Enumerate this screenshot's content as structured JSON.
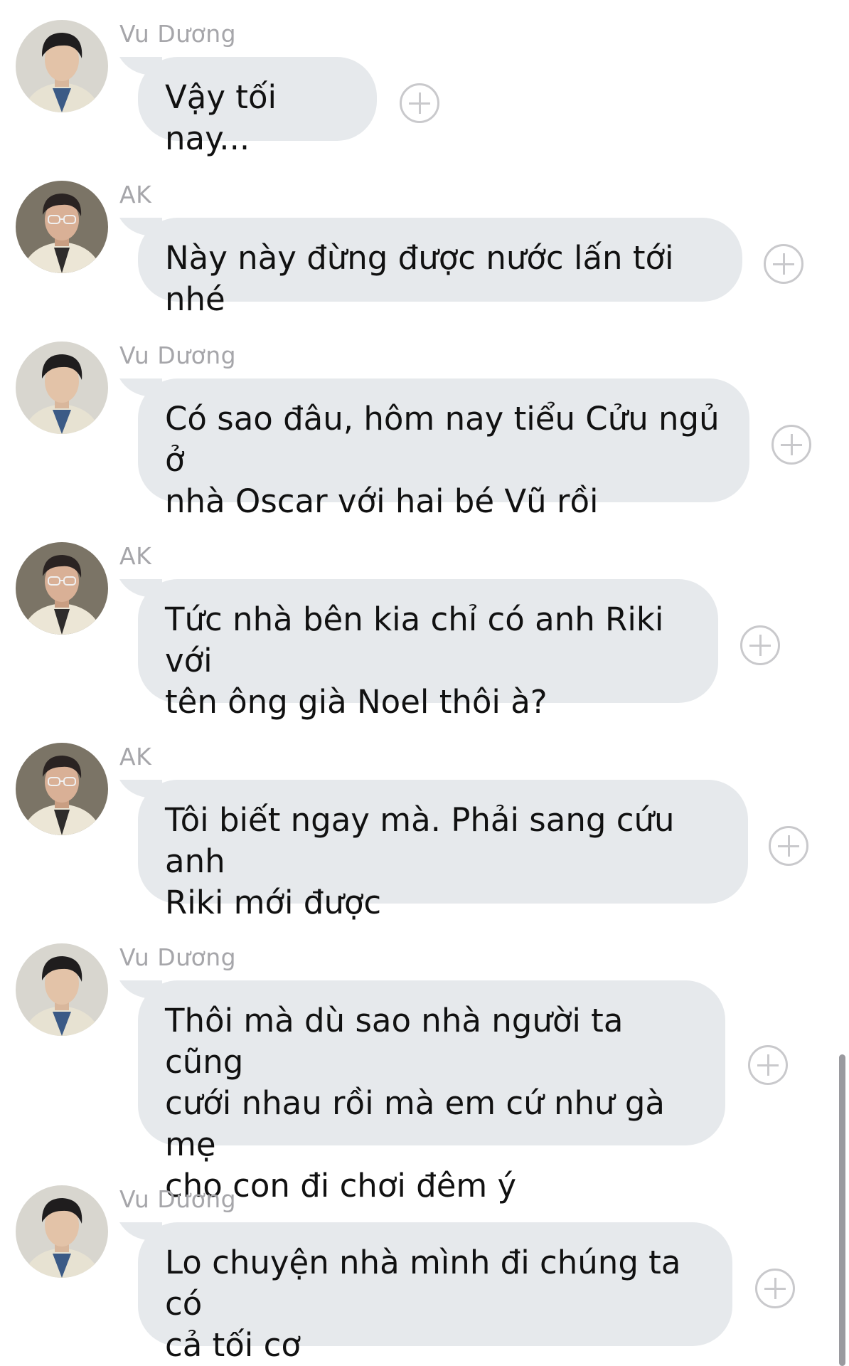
{
  "colors": {
    "bubble": "#e6e9ec",
    "sender_text": "#a6a6aa",
    "message_text": "#111111",
    "add_icon": "#c9c9cc",
    "scrollbar": "#9a9a9f"
  },
  "messages": [
    {
      "sender": "Vu Dương",
      "avatar": "vu-duong-avatar",
      "text": "Vậy tối nay..."
    },
    {
      "sender": "AK",
      "avatar": "ak-avatar",
      "text": "Này này đừng được nước lấn tới nhé"
    },
    {
      "sender": "Vu Dương",
      "avatar": "vu-duong-avatar",
      "text": "Có sao đâu, hôm nay tiểu Cửu ngủ ở\nnhà Oscar với hai bé Vũ rồi"
    },
    {
      "sender": "AK",
      "avatar": "ak-avatar",
      "text": "Tức nhà bên kia chỉ có anh Riki với\ntên ông già Noel thôi à?"
    },
    {
      "sender": "AK",
      "avatar": "ak-avatar",
      "text": "Tôi biết ngay mà. Phải sang cứu anh\nRiki mới được"
    },
    {
      "sender": "Vu Dương",
      "avatar": "vu-duong-avatar",
      "text": "Thôi mà dù sao nhà người ta cũng\ncưới nhau rồi mà em cứ như gà mẹ\ncho con đi chơi đêm ý"
    },
    {
      "sender": "Vu Dương",
      "avatar": "vu-duong-avatar",
      "text": "Lo chuyện nhà mình đi chúng ta có\ncả tối cơ"
    }
  ]
}
